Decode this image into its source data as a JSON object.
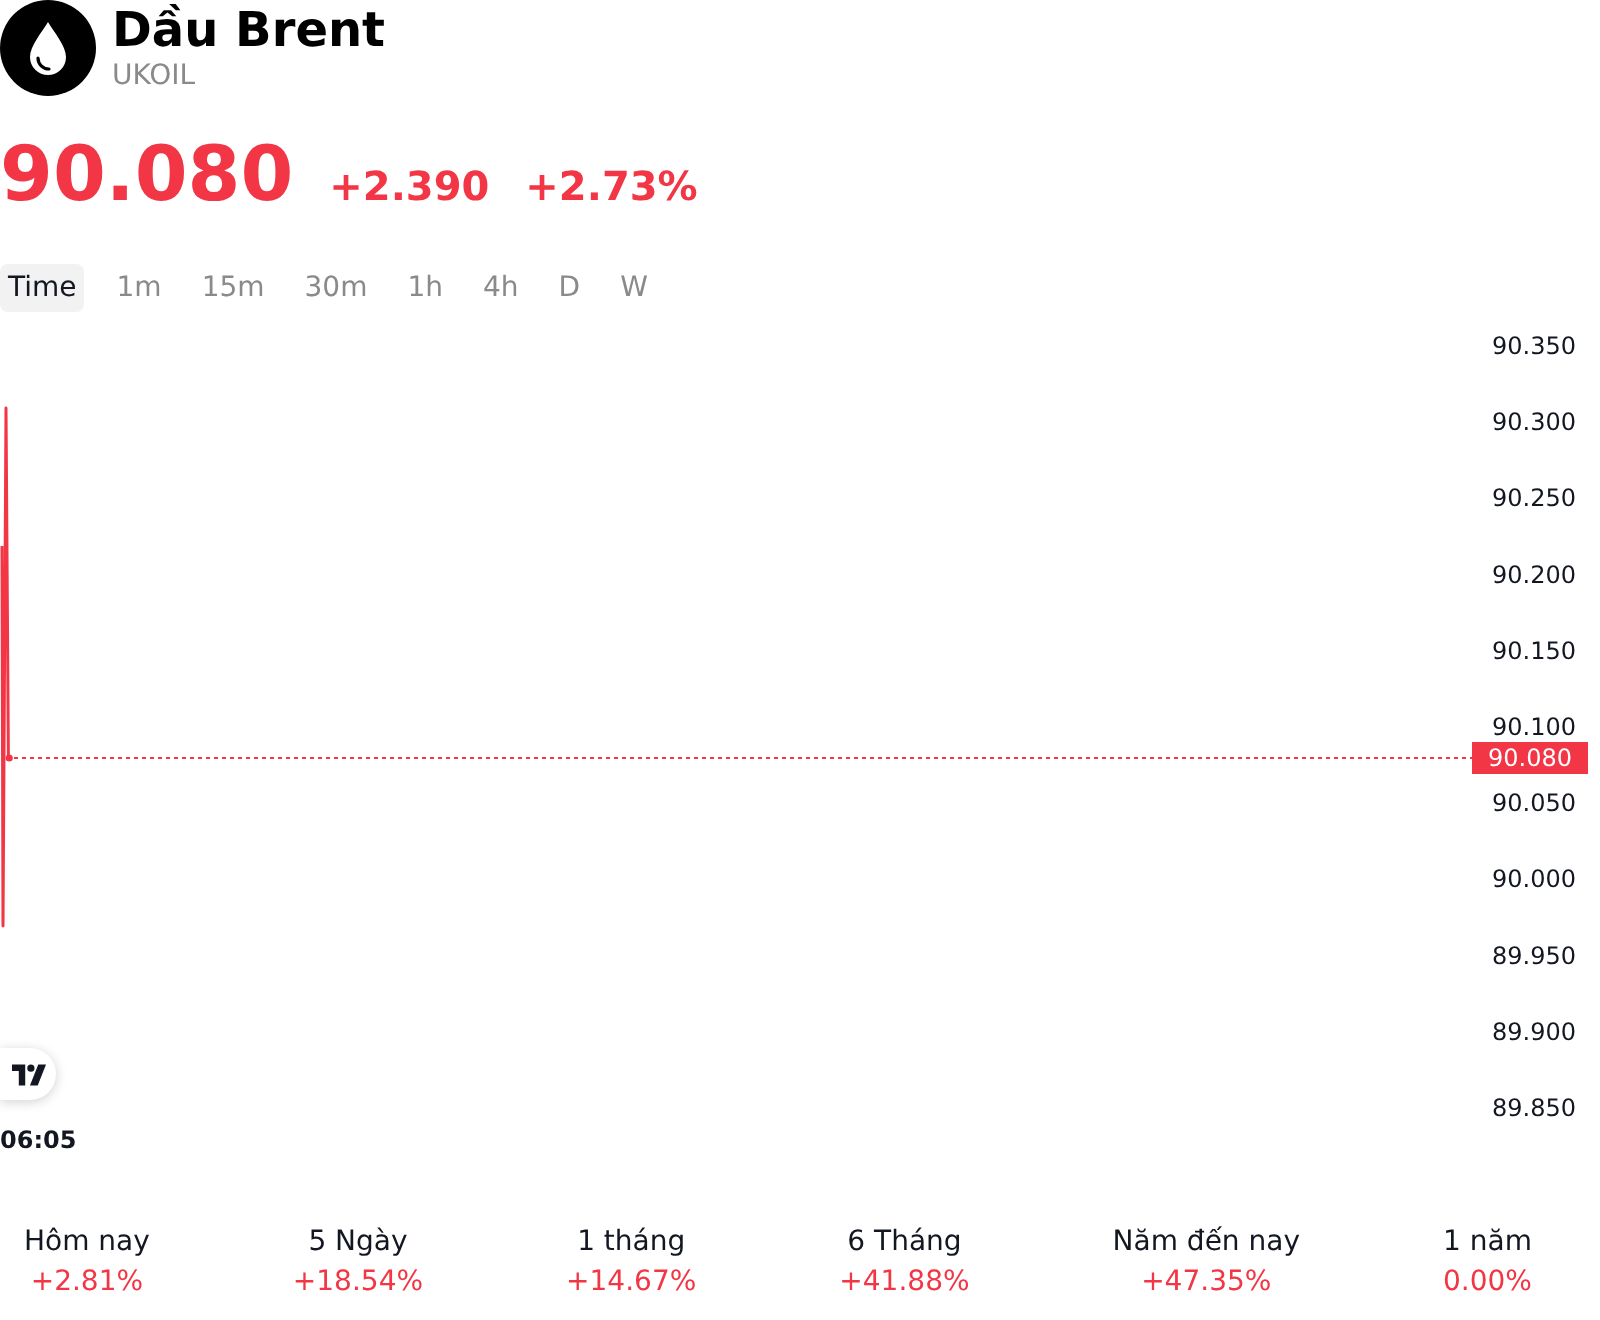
{
  "instrument": {
    "name": "Dầu Brent",
    "symbol": "UKOIL"
  },
  "quote": {
    "price": "90.080",
    "change": "+2.390",
    "change_percent": "+2.73%"
  },
  "tabs": [
    {
      "label": "Time",
      "selected": true
    },
    {
      "label": "1m",
      "selected": false
    },
    {
      "label": "15m",
      "selected": false
    },
    {
      "label": "30m",
      "selected": false
    },
    {
      "label": "1h",
      "selected": false
    },
    {
      "label": "4h",
      "selected": false
    },
    {
      "label": "D",
      "selected": false
    },
    {
      "label": "W",
      "selected": false
    }
  ],
  "chart": {
    "price_axis_labels": [
      "90.350",
      "90.300",
      "90.250",
      "90.200",
      "90.150",
      "90.100",
      "90.050",
      "90.000",
      "89.950",
      "89.900",
      "89.850"
    ],
    "last_price_label": "90.080",
    "time_label": "06:05"
  },
  "performance": [
    {
      "label": "Hôm nay",
      "value": "+2.81%"
    },
    {
      "label": "5 Ngày",
      "value": "+18.54%"
    },
    {
      "label": "1 tháng",
      "value": "+14.67%"
    },
    {
      "label": "6 Tháng",
      "value": "+41.88%"
    },
    {
      "label": "Năm đến nay",
      "value": "+47.35%"
    },
    {
      "label": "1 năm",
      "value": "0.00%"
    }
  ]
}
